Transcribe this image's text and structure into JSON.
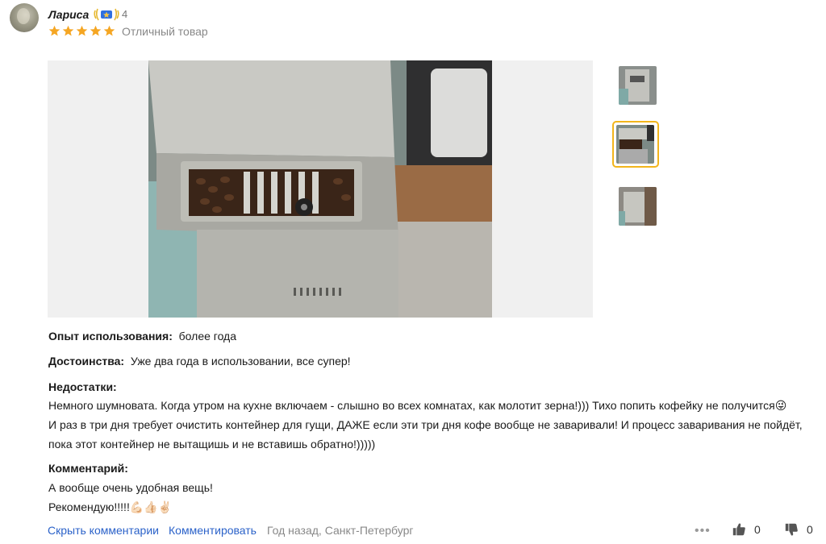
{
  "review": {
    "author": "Лариса",
    "badge_count": "4",
    "stars": 5,
    "rating_text": "Отличный товар",
    "experience_label": "Опыт использования:",
    "experience_value": "более года",
    "pros_label": "Достоинства:",
    "pros_value": "Уже два года в использовании, все супер!",
    "cons_label": "Недостатки:",
    "cons_line1": "Немного шумновата. Когда утром на кухне включаем - слышно во всех комнатах, как молотит зерна!))) Тихо попить кофейку не получится😜",
    "cons_line2": "И раз в три дня требует очистить контейнер для гущи, ДАЖЕ если эти три дня кофе вообще не заваривали! И процесс заваривания не пойдёт,",
    "cons_line3": "пока этот контейнер не вытащишь и не вставишь обратно!)))))",
    "comment_label": "Комментарий:",
    "comment_line1": "А вообще очень удобная вещь!",
    "comment_line2": "Рекомендую!!!!!💪🏻👍🏻✌🏻"
  },
  "footer": {
    "hide_comments": "Скрыть комментарии",
    "comment": "Комментировать",
    "meta": "Год назад, Санкт-Петербург",
    "likes": "0",
    "dislikes": "0"
  },
  "colors": {
    "star": "#f5a623",
    "link": "#2b62c9",
    "thumb_selected_border": "#f2b51c"
  }
}
